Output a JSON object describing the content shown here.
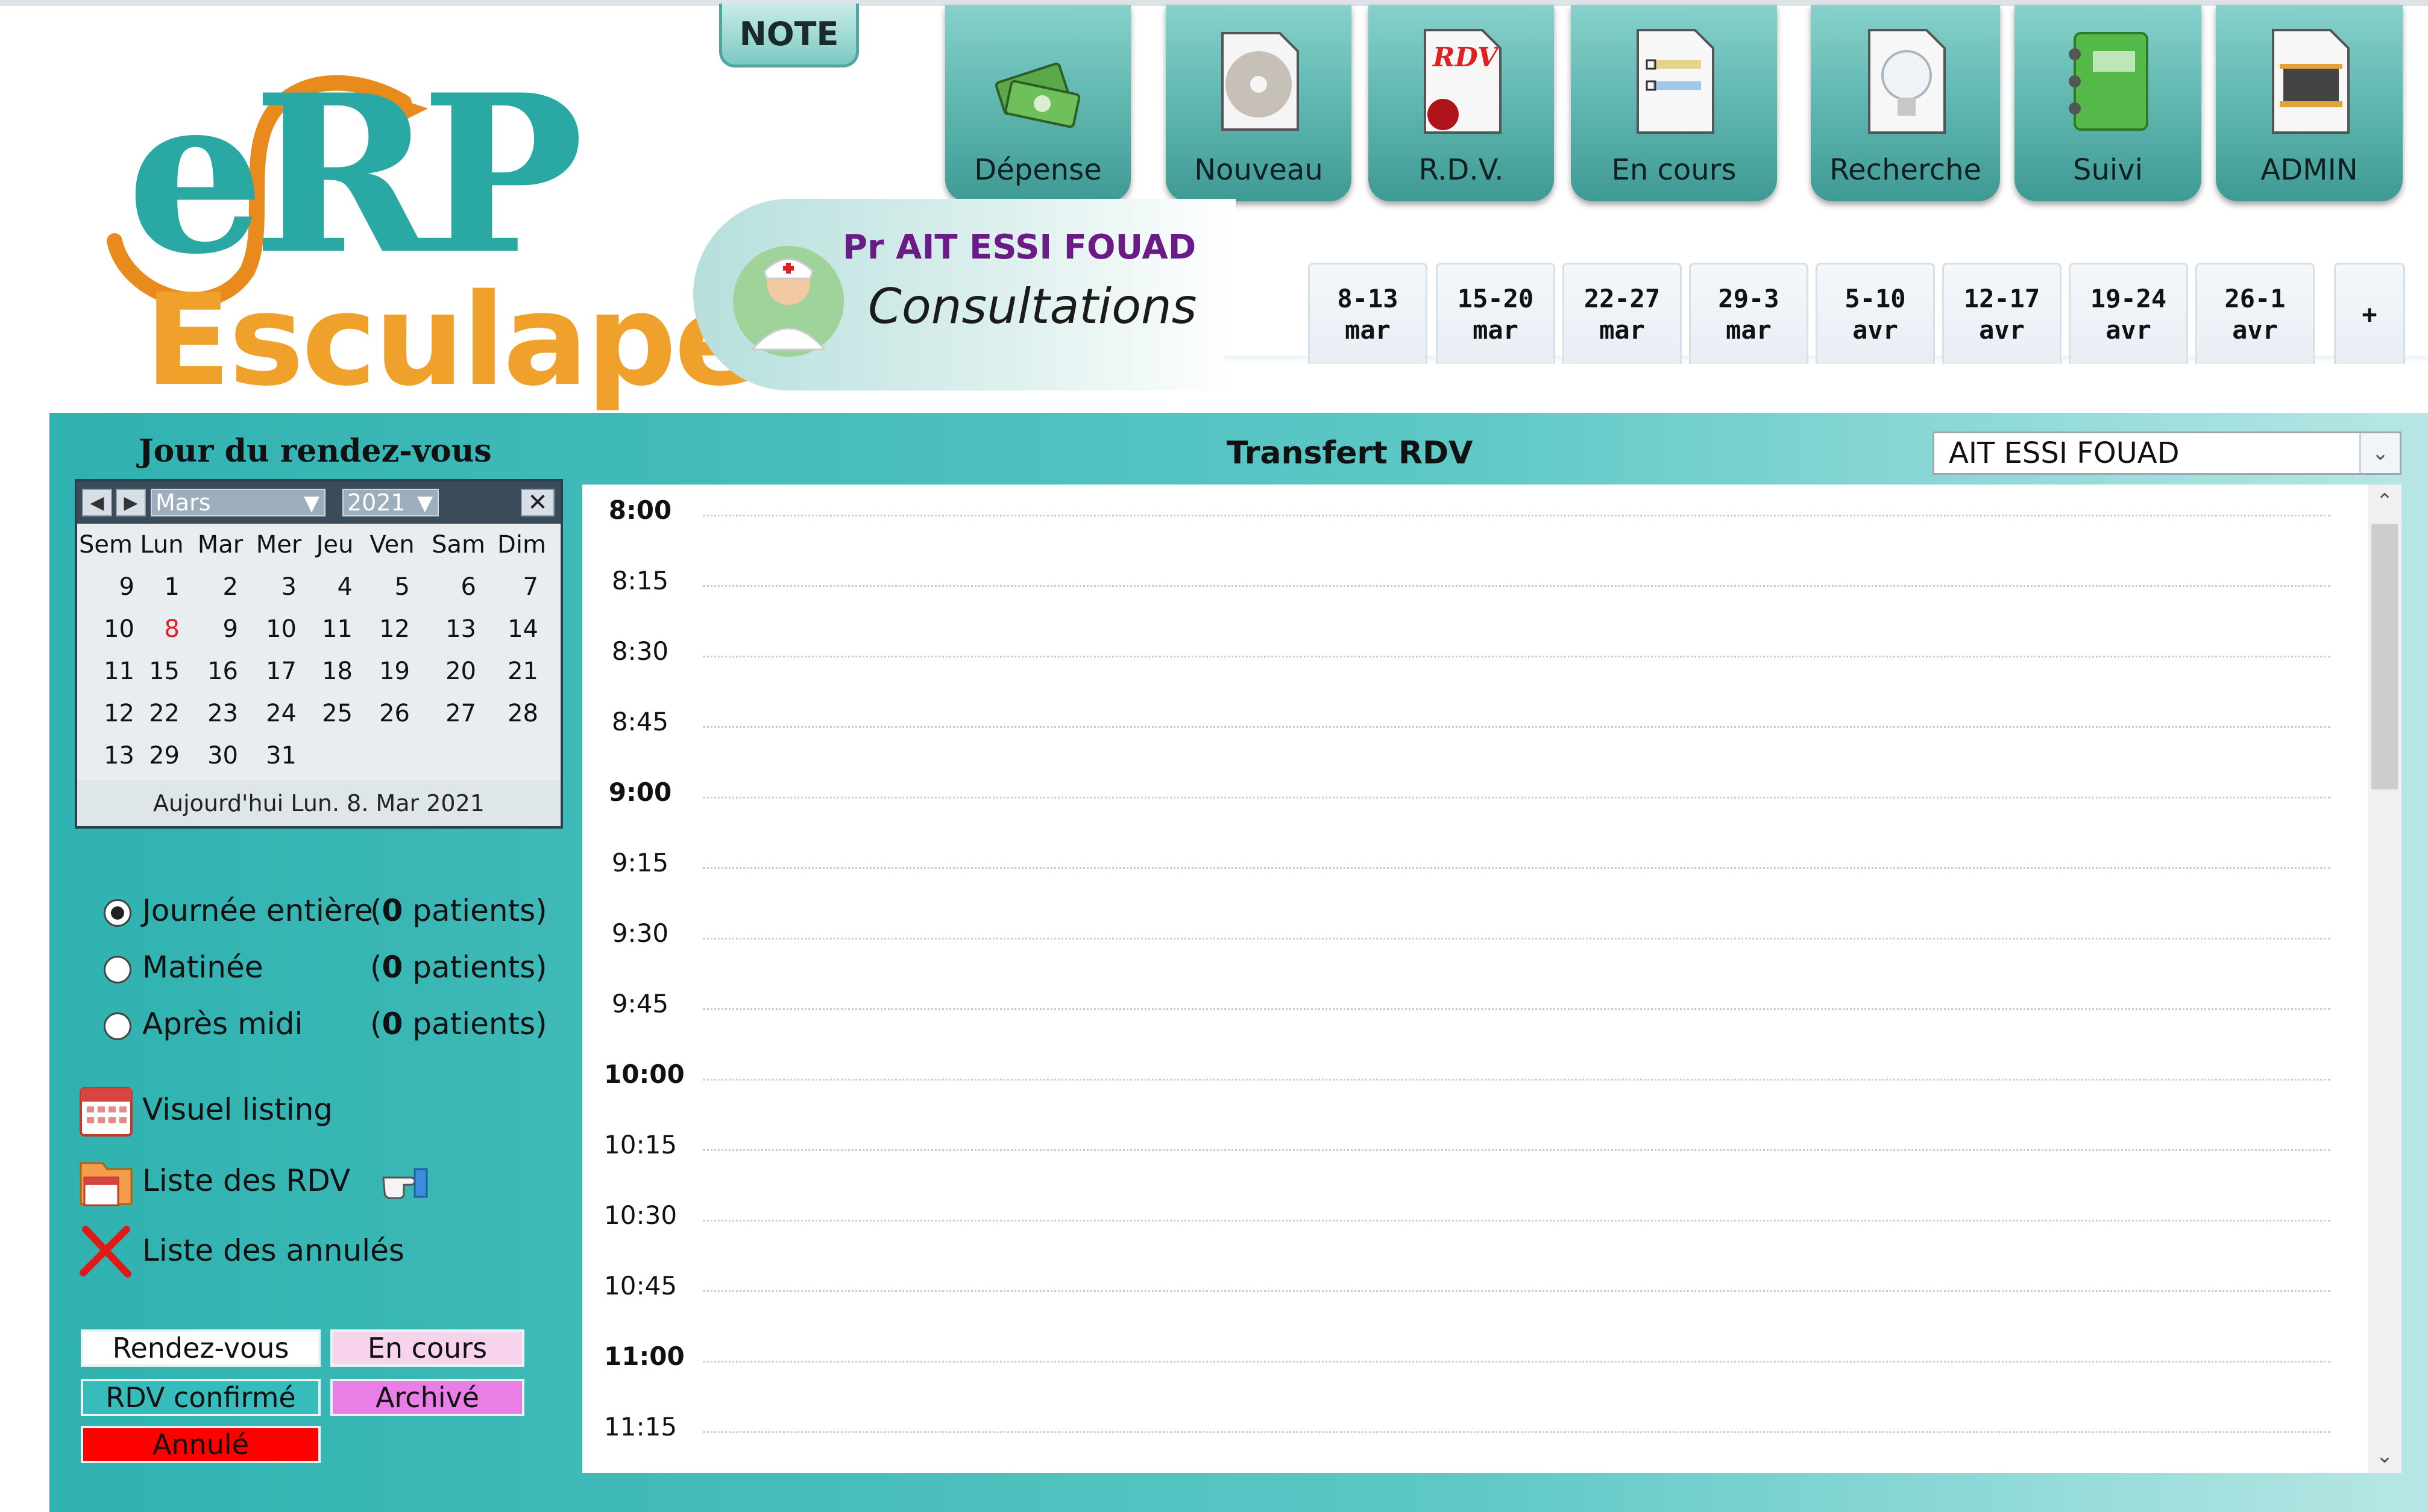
{
  "logo": {
    "top": "eRP",
    "bottom": "Esculape"
  },
  "note_label": "NOTE",
  "toolbar": [
    {
      "id": "depense",
      "label": "Dépense",
      "icon": "money-stack-icon"
    },
    {
      "id": "nouveau",
      "label": "Nouveau",
      "icon": "new-file-icon"
    },
    {
      "id": "rdv",
      "label": "R.D.V.",
      "icon": "rdv-document-icon"
    },
    {
      "id": "encours",
      "label": "En cours",
      "icon": "list-document-icon"
    },
    {
      "id": "recherche",
      "label": "Recherche",
      "icon": "lightbulb-icon"
    },
    {
      "id": "suivi",
      "label": "Suivi",
      "icon": "notebook-icon"
    },
    {
      "id": "admin",
      "label": "ADMIN",
      "icon": "rom-chip-icon"
    }
  ],
  "header": {
    "doctor": "Pr AIT ESSI FOUAD",
    "section": "Consultations"
  },
  "weeks": [
    {
      "range": "8-13",
      "month": "mar"
    },
    {
      "range": "15-20",
      "month": "mar"
    },
    {
      "range": "22-27",
      "month": "mar"
    },
    {
      "range": "29-3",
      "month": "mar"
    },
    {
      "range": "5-10",
      "month": "avr"
    },
    {
      "range": "12-17",
      "month": "avr"
    },
    {
      "range": "19-24",
      "month": "avr"
    },
    {
      "range": "26-1",
      "month": "avr"
    }
  ],
  "weeks_more": "+",
  "left": {
    "title": "Jour du rendez-vous",
    "calendar": {
      "month": "Mars",
      "year": "2021",
      "headers": [
        "Sem",
        "Lun",
        "Mar",
        "Mer",
        "Jeu",
        "Ven",
        "Sam",
        "Dim"
      ],
      "rows": [
        [
          "9",
          "1",
          "2",
          "3",
          "4",
          "5",
          "6",
          "7"
        ],
        [
          "10",
          "8",
          "9",
          "10",
          "11",
          "12",
          "13",
          "14"
        ],
        [
          "11",
          "15",
          "16",
          "17",
          "18",
          "19",
          "20",
          "21"
        ],
        [
          "12",
          "22",
          "23",
          "24",
          "25",
          "26",
          "27",
          "28"
        ],
        [
          "13",
          "29",
          "30",
          "31",
          "",
          "",
          "",
          ""
        ]
      ],
      "today_label": "Aujourd'hui Lun. 8. Mar 2021",
      "today_color": "#e02020"
    },
    "options": [
      {
        "label": "Journée entière",
        "count": "0",
        "selected": true
      },
      {
        "label": "Matinée",
        "count": "0",
        "selected": false
      },
      {
        "label": "Après midi",
        "count": "0",
        "selected": false
      }
    ],
    "count_open": "(",
    "count_suffix": " patients)",
    "links": {
      "visuel": "Visuel listing",
      "liste": "Liste des RDV",
      "annules": "Liste des annulés"
    },
    "legend": {
      "rdv": {
        "label": "Rendez-vous",
        "color": "#ffffff"
      },
      "encours": {
        "label": "En cours",
        "color": "#f7d3ee"
      },
      "confirme": {
        "label": "RDV confirmé",
        "color": "#36bdbb"
      },
      "archive": {
        "label": "Archivé",
        "color": "#e97fe6"
      },
      "annule": {
        "label": "Annulé",
        "color": "#ff0000"
      }
    }
  },
  "schedule": {
    "title": "Transfert RDV",
    "doctor_select": "AIT ESSI FOUAD",
    "slots": [
      "8:00",
      "8:15",
      "8:30",
      "8:45",
      "9:00",
      "9:15",
      "9:30",
      "9:45",
      "10:00",
      "10:15",
      "10:30",
      "10:45",
      "11:00",
      "11:15"
    ]
  },
  "colors": {
    "teal": "#2fb2b0",
    "purple": "#6a1b87",
    "orange": "#f0a12b"
  }
}
